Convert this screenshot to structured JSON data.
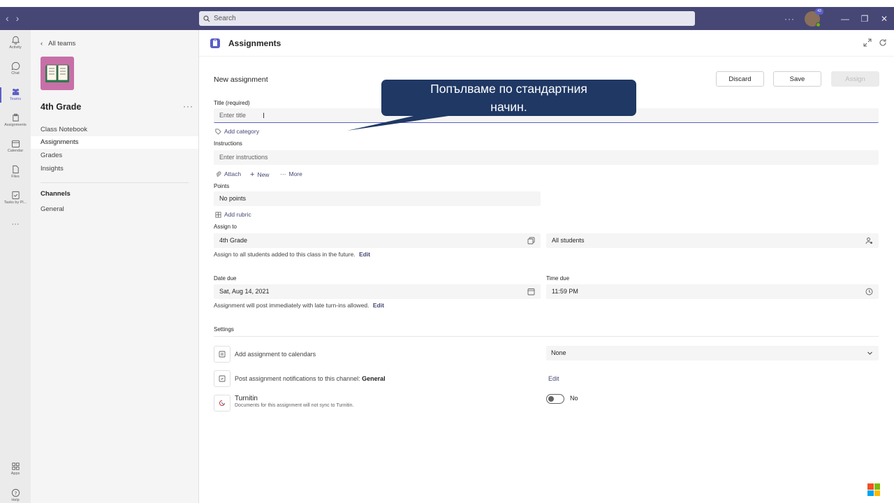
{
  "titlebar": {
    "search_placeholder": "Search",
    "notification_badge": "43"
  },
  "rail": {
    "items": [
      {
        "label": "Activity",
        "icon": "bell-icon"
      },
      {
        "label": "Chat",
        "icon": "chat-icon"
      },
      {
        "label": "Teams",
        "icon": "teams-icon",
        "active": true
      },
      {
        "label": "Assignments",
        "icon": "assignments-icon"
      },
      {
        "label": "Calendar",
        "icon": "calendar-icon"
      },
      {
        "label": "Files",
        "icon": "files-icon"
      },
      {
        "label": "Tasks by Pl...",
        "icon": "tasks-icon"
      },
      {
        "label": "Apps",
        "icon": "apps-icon"
      },
      {
        "label": "Help",
        "icon": "help-icon"
      }
    ]
  },
  "teampanel": {
    "back_label": "All teams",
    "team_name": "4th Grade",
    "nav": [
      "Class Notebook",
      "Assignments",
      "Grades",
      "Insights"
    ],
    "channels_heading": "Channels",
    "channels": [
      "General"
    ]
  },
  "header": {
    "app_title": "Assignments"
  },
  "form": {
    "heading": "New assignment",
    "buttons": {
      "discard": "Discard",
      "save": "Save",
      "assign": "Assign"
    },
    "title_label": "Title (required)",
    "title_placeholder": "Enter title",
    "add_category": "Add category",
    "instructions_label": "Instructions",
    "instructions_placeholder": "Enter instructions",
    "attach": "Attach",
    "new": "New",
    "more": "More",
    "points_label": "Points",
    "points_value": "No points",
    "add_rubric": "Add rubric",
    "assign_to_label": "Assign to",
    "assign_to_class": "4th Grade",
    "assign_to_students": "All students",
    "assign_helper": "Assign to all students added to this class in the future.",
    "edit": "Edit",
    "date_due_label": "Date due",
    "date_due_value": "Sat, Aug 14, 2021",
    "time_due_label": "Time due",
    "time_due_value": "11:59 PM",
    "post_helper": "Assignment will post immediately with late turn-ins allowed.",
    "settings_label": "Settings",
    "calendar_setting": "Add assignment to calendars",
    "calendar_value": "None",
    "notify_setting_prefix": "Post assignment notifications to this channel:",
    "notify_channel": "General",
    "turnitin_title": "Turnitin",
    "turnitin_sub": "Documents for this assignment will not sync to Turnitin.",
    "turnitin_toggle": "No"
  },
  "callout": {
    "line1": "Попълваме по стандартния",
    "line2": "начин."
  },
  "colors": {
    "titlebar": "#464775",
    "accent": "#5b5fc7",
    "callout": "#1f3864"
  }
}
